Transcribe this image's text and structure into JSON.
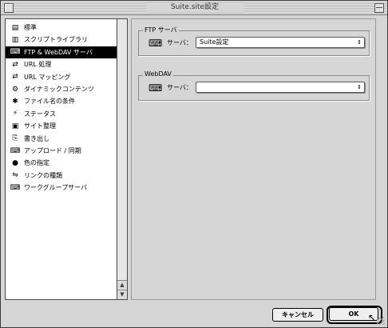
{
  "window": {
    "title": "Suite.site設定"
  },
  "sidebar": {
    "items": [
      {
        "label": "標準",
        "icon": "document-icon",
        "glyph": "▤",
        "selected": false
      },
      {
        "label": "スクリプトライブラリ",
        "icon": "script-library-icon",
        "glyph": "▥",
        "selected": false
      },
      {
        "label": "FTP & WebDAV サーバ",
        "icon": "server-icon",
        "glyph": "⌨",
        "selected": true
      },
      {
        "label": "URL 処理",
        "icon": "url-arrows-icon",
        "glyph": "⇄",
        "selected": false
      },
      {
        "label": "URL マッピング",
        "icon": "url-mapping-icon",
        "glyph": "⇄",
        "selected": false
      },
      {
        "label": "ダイナミックコンテンツ",
        "icon": "gear-icon",
        "glyph": "⚙",
        "selected": false
      },
      {
        "label": "ファイル名の条件",
        "icon": "filename-icon",
        "glyph": "✱",
        "selected": false
      },
      {
        "label": "ステータス",
        "icon": "status-icon",
        "glyph": "⚡",
        "selected": false
      },
      {
        "label": "サイト整理",
        "icon": "site-organize-icon",
        "glyph": "▣",
        "selected": false
      },
      {
        "label": "書き出し",
        "icon": "export-icon",
        "glyph": "⎘",
        "selected": false
      },
      {
        "label": "アップロード / 同期",
        "icon": "upload-sync-icon",
        "glyph": "⌨",
        "selected": false
      },
      {
        "label": "色の指定",
        "icon": "color-icon",
        "glyph": "●",
        "selected": false
      },
      {
        "label": "リンクの種類",
        "icon": "link-type-icon",
        "glyph": "⇋",
        "selected": false
      },
      {
        "label": "ワークグループサーバ",
        "icon": "workgroup-server-icon",
        "glyph": "⌨",
        "selected": false
      }
    ]
  },
  "main": {
    "ftp": {
      "title": "FTP サーバ",
      "server_label": "サーバ：",
      "value": "Suite設定"
    },
    "webdav": {
      "title": "WebDAV",
      "server_label": "サーバ：",
      "value": ""
    }
  },
  "buttons": {
    "cancel": "キャンセル",
    "ok": "OK"
  },
  "colors": {
    "selection": "#000000",
    "window_bg": "#d6d6d6"
  }
}
